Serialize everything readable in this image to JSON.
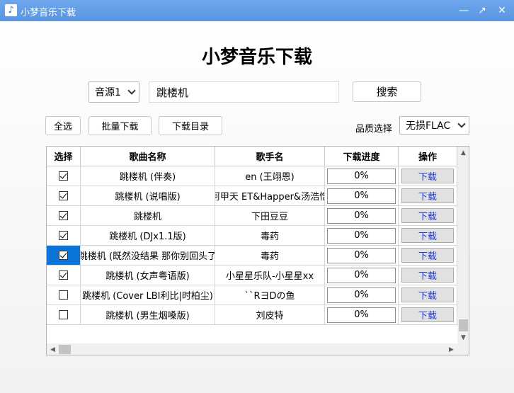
{
  "window": {
    "title": "小梦音乐下载",
    "minimize_glyph": "—",
    "maximize_glyph": "↗",
    "close_glyph": "✕",
    "app_icon": "music-note-icon"
  },
  "header": {
    "title": "小梦音乐下载"
  },
  "search": {
    "source_selected": "音源1",
    "query": "跳楼机",
    "button_label": "搜索"
  },
  "toolbar": {
    "select_all_label": "全选",
    "batch_download_label": "批量下载",
    "download_dir_label": "下载目录",
    "quality_label": "品质选择",
    "quality_selected": "无损FLAC"
  },
  "table": {
    "columns": [
      "选择",
      "歌曲名称",
      "歌手名",
      "下载进度",
      "操作"
    ],
    "rows": [
      {
        "checked": true,
        "selected": false,
        "song": "跳楼机 (伴奏)",
        "artist": "en (王翊恩)",
        "progress": "0%",
        "action": "下载"
      },
      {
        "checked": true,
        "selected": false,
        "song": "跳楼机 (说唱版)",
        "artist": "阿甲天 ET&Happer&汤浩恺",
        "progress": "0%",
        "action": "下载"
      },
      {
        "checked": true,
        "selected": false,
        "song": "跳楼机",
        "artist": "下田豆豆",
        "progress": "0%",
        "action": "下载"
      },
      {
        "checked": true,
        "selected": false,
        "song": "跳楼机 (DJx1.1版)",
        "artist": "毒药",
        "progress": "0%",
        "action": "下载"
      },
      {
        "checked": true,
        "selected": true,
        "song": "跳楼机 (既然没结果 那你别回头了",
        "artist": "毒药",
        "progress": "0%",
        "action": "下载"
      },
      {
        "checked": true,
        "selected": false,
        "song": "跳楼机  (女声粤语版)",
        "artist": "小星星乐队-小星星xx",
        "progress": "0%",
        "action": "下载"
      },
      {
        "checked": false,
        "selected": false,
        "song": "跳楼机 (Cover LBI利比|时柏尘)",
        "artist": "``RヨDの鱼",
        "progress": "0%",
        "action": "下载"
      },
      {
        "checked": false,
        "selected": false,
        "song": "跳楼机 (男生烟嗓版)",
        "artist": "刘皮特",
        "progress": "0%",
        "action": "下载"
      }
    ]
  }
}
